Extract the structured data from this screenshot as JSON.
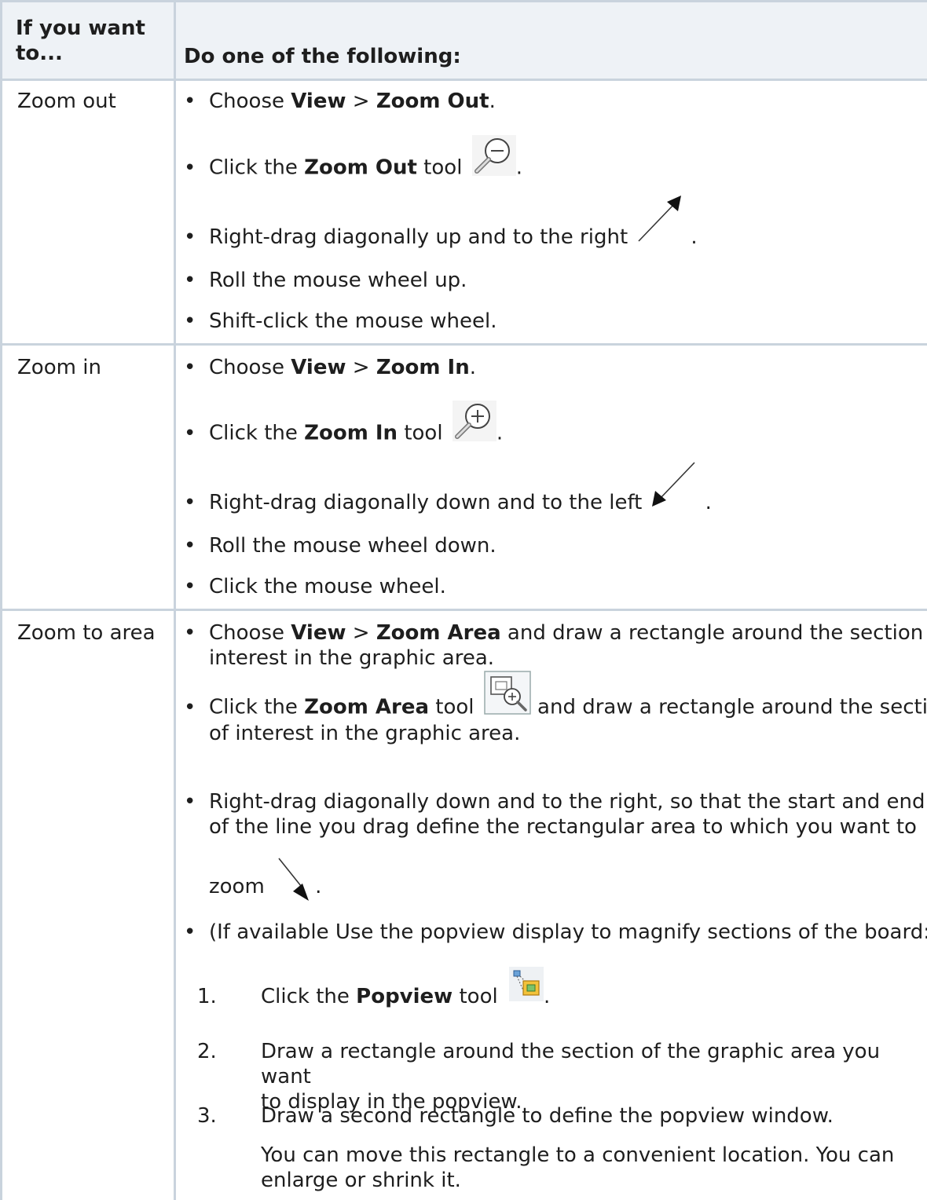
{
  "header": {
    "col1": "If you want to...",
    "col2": "Do one of the following:"
  },
  "rows": [
    {
      "label": "Zoom out",
      "items": {
        "i1": {
          "pre": "Choose ",
          "b1": "View",
          "mid": " > ",
          "b2": "Zoom Out",
          "post": "."
        },
        "i2": {
          "pre": "Click the ",
          "b1": "Zoom Out",
          "post": " tool",
          "end": "."
        },
        "i3": {
          "text": "Right-drag diagonally up and to the right",
          "end": "."
        },
        "i4": {
          "text": "Roll the mouse wheel up."
        },
        "i5": {
          "text": "Shift-click the mouse wheel."
        }
      }
    },
    {
      "label": "Zoom in",
      "items": {
        "i1": {
          "pre": "Choose ",
          "b1": "View",
          "mid": " > ",
          "b2": "Zoom In",
          "post": "."
        },
        "i2": {
          "pre": "Click the ",
          "b1": "Zoom In",
          "post": " tool",
          "end": "."
        },
        "i3": {
          "text": "Right-drag diagonally down and to the left",
          "end": "."
        },
        "i4": {
          "text": "Roll the mouse wheel down."
        },
        "i5": {
          "text": "Click the mouse wheel."
        }
      }
    },
    {
      "label": "Zoom to area",
      "items": {
        "i1": {
          "pre": "Choose ",
          "b1": "View",
          "mid": " > ",
          "b2": "Zoom Area",
          "post": " and draw a rectangle around the section of",
          "line2": "interest in the graphic area."
        },
        "i2": {
          "pre": "Click the ",
          "b1": "Zoom Area",
          "post": " tool",
          "post2": " and draw a rectangle around the section",
          "line2": "of interest in the graphic area."
        },
        "i3": {
          "line1": "Right-drag diagonally down and to the right, so that the start and end",
          "line2": "of the line you drag define the rectangular area to which you want to",
          "line3": "zoom",
          "end": "."
        },
        "i4": {
          "text": "(If available Use the popview display to magnify sections of the board:"
        },
        "steps": {
          "s1": {
            "num": "1.",
            "pre": "Click the ",
            "b1": "Popview",
            "post": " tool",
            "end": "."
          },
          "s2": {
            "num": "2.",
            "line1": "Draw a rectangle around the section of the graphic area you want",
            "line2": "to display in the popview."
          },
          "s3": {
            "num": "3.",
            "text": "Draw a second rectangle to define the popview window.",
            "note1": "You can move this rectangle to a convenient location. You can",
            "note2": "enlarge or shrink it."
          }
        }
      }
    }
  ],
  "bullet": "•",
  "icons": [
    "zoom-out-icon",
    "drag-up-right-arrow-icon",
    "zoom-in-icon",
    "drag-down-left-arrow-icon",
    "zoom-area-icon",
    "drag-down-right-arrow-icon",
    "popview-icon"
  ]
}
